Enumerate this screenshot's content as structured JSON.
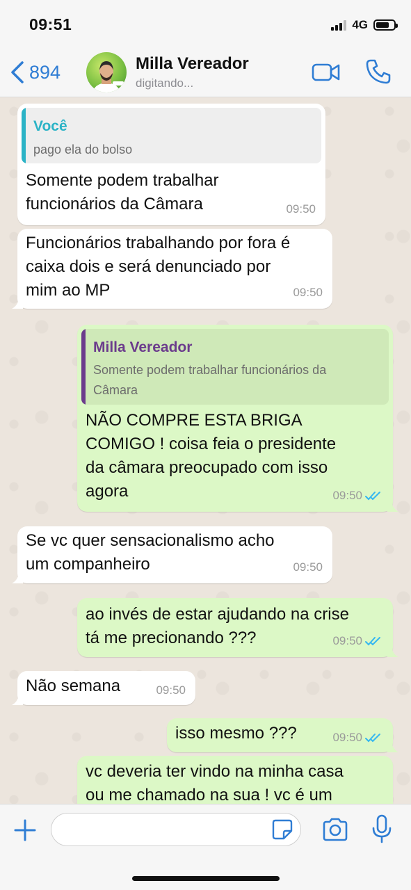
{
  "status_bar": {
    "time": "09:51",
    "network": "4G",
    "signal_bars": 3,
    "battery_level": 0.75
  },
  "header": {
    "back_count": "894",
    "contact_name": "Milla Vereador",
    "contact_status": "digitando...",
    "icons": {
      "back": "chevron-left-icon",
      "video": "video-camera-icon",
      "call": "phone-icon"
    }
  },
  "messages": [
    {
      "direction": "incoming",
      "quote": {
        "author": "Você",
        "text": "pago ela do bolso",
        "color": "#2bb3c6"
      },
      "lines": [
        "Somente podem trabalhar",
        "funcionários da Câmara"
      ],
      "time": "09:50"
    },
    {
      "direction": "incoming",
      "lines": [
        "Funcionários trabalhando por fora é",
        "caixa dois e será denunciado por",
        "mim ao MP"
      ],
      "time": "09:50"
    },
    {
      "direction": "outgoing",
      "quote": {
        "author": "Milla Vereador",
        "lines": [
          "Somente podem trabalhar funcionários da",
          "Câmara"
        ],
        "color": "#6b3b8c"
      },
      "lines": [
        "NÃO COMPRE ESTA BRIGA",
        "COMIGO ! coisa feia o presidente",
        "da câmara preocupado com isso",
        "agora"
      ],
      "time": "09:50",
      "read": true
    },
    {
      "direction": "incoming",
      "lines": [
        "Se vc quer sensacionalismo acho",
        "um companheiro"
      ],
      "time": "09:50"
    },
    {
      "direction": "outgoing",
      "lines": [
        "ao invés de estar ajudando na crise",
        "tá me precionando ???"
      ],
      "time": "09:50",
      "read": true
    },
    {
      "direction": "incoming",
      "lines": [
        "Não semana"
      ],
      "time": "09:50"
    },
    {
      "direction": "outgoing",
      "lines": [
        "isso mesmo ???"
      ],
      "time": "09:50",
      "read": true
    },
    {
      "direction": "outgoing",
      "lines": [
        "vc deveria ter vindo na minha casa",
        "ou me chamado na sua ! vc é um"
      ],
      "time": "",
      "read": false
    }
  ],
  "input_bar": {
    "placeholder": "",
    "icons": {
      "plus": "plus-icon",
      "sticker": "sticker-icon",
      "camera": "camera-icon",
      "mic": "microphone-icon"
    }
  },
  "colors": {
    "accent": "#2f7dd4",
    "incoming_bubble": "#ffffff",
    "outgoing_bubble": "#dcf8c6",
    "read_ticks": "#34b7f1",
    "chat_background": "#ece5dd"
  }
}
